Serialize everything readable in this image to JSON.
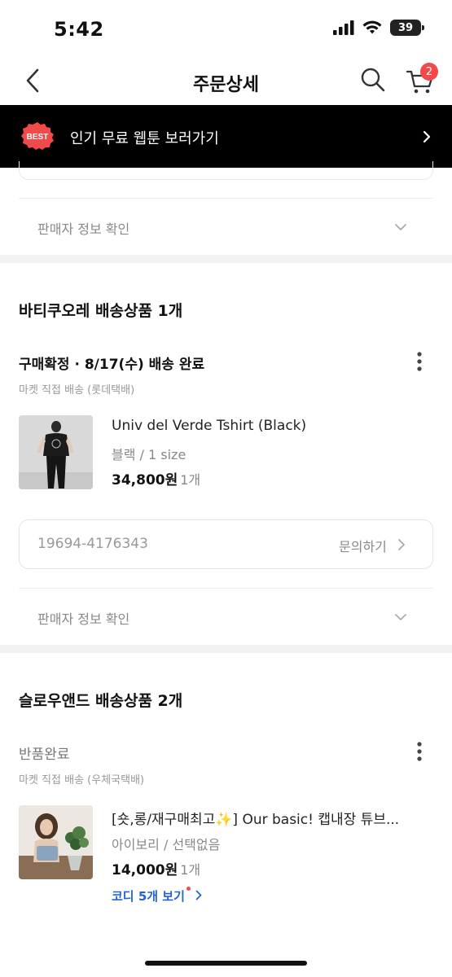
{
  "status_bar": {
    "time": "5:42",
    "battery": "39"
  },
  "nav": {
    "title": "주문상세",
    "cart_count": "2"
  },
  "banner": {
    "badge": "BEST",
    "text": "인기 무료 웹툰 보러가기"
  },
  "seller_info_label": "판매자 정보 확인",
  "sections": [
    {
      "title": "바티쿠오레 배송상품 1개",
      "status": "구매확정 · 8/17(수) 배송 완료",
      "shipping": "마켓 직접 배송 (롯데택배)",
      "product": {
        "name": "Univ del Verde Tshirt (Black)",
        "option": "블랙 / 1 size",
        "price": "34,800원",
        "qty": "1개"
      },
      "order_number": "19694-4176343",
      "inquiry_label": "문의하기",
      "seller_info_label": "판매자 정보 확인"
    },
    {
      "title": "슬로우앤드 배송상품 2개",
      "status": "반품완료",
      "shipping": "마켓 직접 배송 (우체국택배)",
      "product": {
        "name": "[숏,롱/재구매최고✨] Our basic! 캡내장 튜브...",
        "option": "아이보리 / 선택없음",
        "price": "14,000원",
        "qty": "1개"
      },
      "coordi_link": "코디 5개 보기"
    }
  ],
  "colors": {
    "accent_red": "#f24a4a",
    "link_blue": "#2463d6",
    "banner_bg": "#000000"
  }
}
